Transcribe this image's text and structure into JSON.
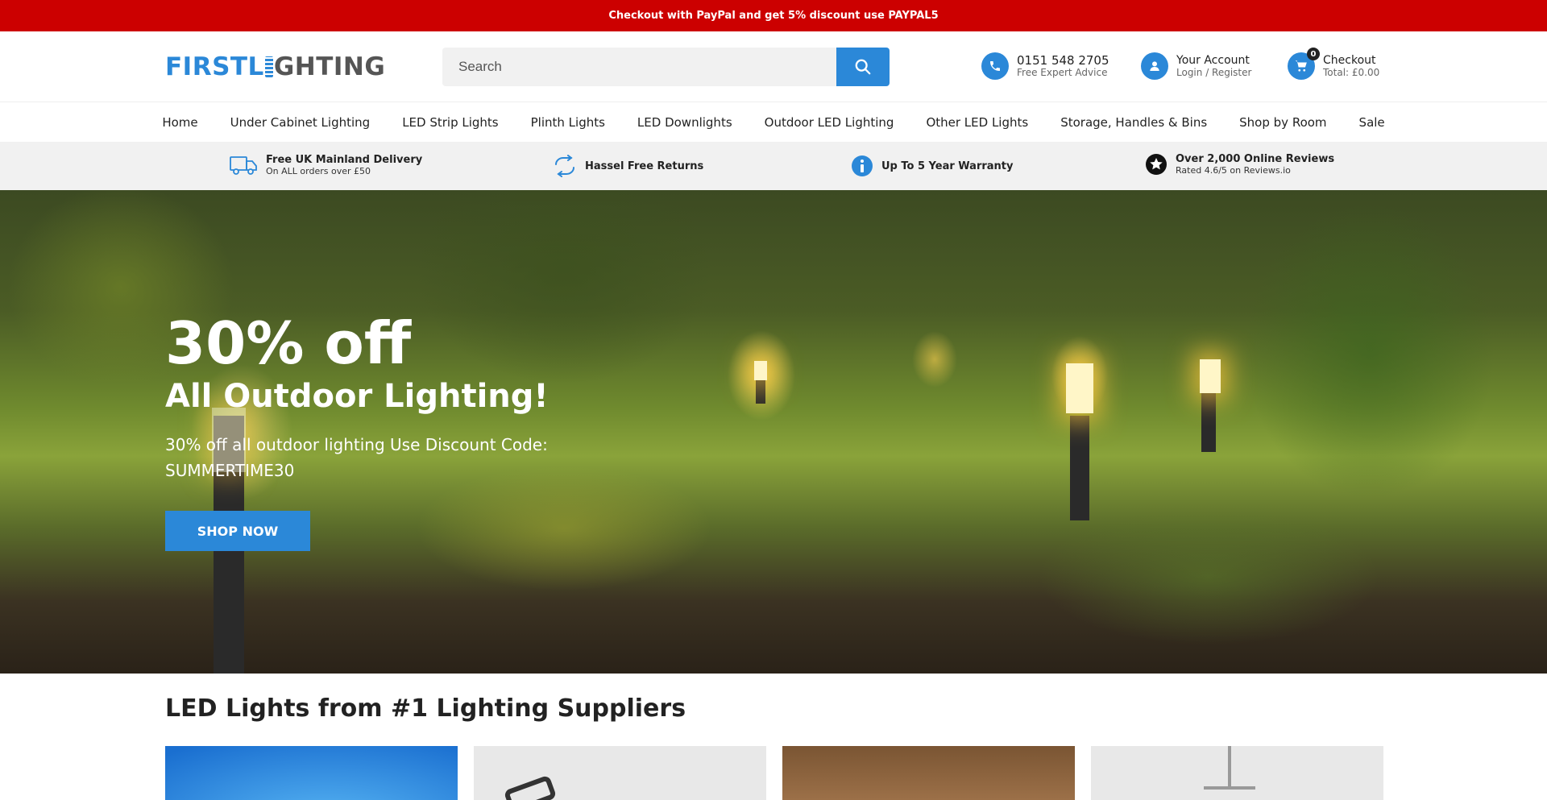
{
  "promo": {
    "text": "Checkout with PayPal and get 5% discount use PAYPAL5"
  },
  "header": {
    "logo_first": "FIRSTL",
    "logo_rest": "GHTING",
    "search_placeholder": "Search",
    "phone": {
      "number": "0151 548 2705",
      "subtitle": "Free Expert Advice"
    },
    "account": {
      "title": "Your Account",
      "subtitle": "Login / Register"
    },
    "cart": {
      "count": "0",
      "title": "Checkout",
      "total": "Total: £0.00"
    }
  },
  "nav": {
    "items": [
      "Home",
      "Under Cabinet Lighting",
      "LED Strip Lights",
      "Plinth Lights",
      "LED Downlights",
      "Outdoor LED Lighting",
      "Other LED Lights",
      "Storage, Handles & Bins",
      "Shop by Room",
      "Sale"
    ]
  },
  "usps": [
    {
      "icon": "truck-icon",
      "title": "Free UK Mainland Delivery",
      "subtitle": "On ALL orders over £50"
    },
    {
      "icon": "returns-icon",
      "title": "Hassel Free Returns",
      "subtitle": ""
    },
    {
      "icon": "info-icon",
      "title": "Up To 5 Year Warranty",
      "subtitle": ""
    },
    {
      "icon": "star-icon",
      "title": "Over 2,000 Online Reviews",
      "subtitle": "Rated 4.6/5 on Reviews.io"
    }
  ],
  "hero": {
    "title": "30% off",
    "subtitle": "All Outdoor Lighting!",
    "description": "30% off all outdoor lighting Use Discount Code: SUMMERTIME30",
    "button": "SHOP NOW"
  },
  "section": {
    "title": "LED Lights from #1 Lighting Suppliers"
  },
  "colors": {
    "accent": "#2b88d8",
    "promo": "#cc0000"
  }
}
